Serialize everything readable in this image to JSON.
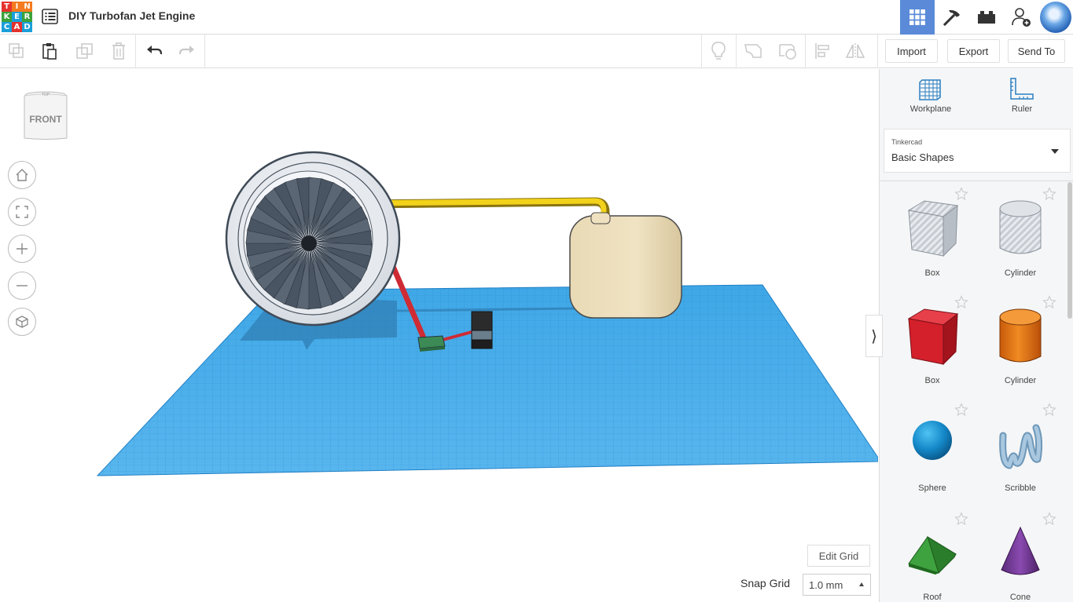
{
  "app": {
    "logo_letters": [
      "T",
      "I",
      "N",
      "K",
      "E",
      "R",
      "C",
      "A",
      "D"
    ],
    "logo_colors": [
      "#e5322e",
      "#f47b20",
      "#f47b20",
      "#3ca23c",
      "#1a9fd9",
      "#3ca23c",
      "#1a9fd9",
      "#e5322e",
      "#1a9fd9"
    ],
    "document_title": "DIY Turbofan Jet Engine",
    "accent": "#5a8ad8"
  },
  "toolbar": {
    "import_label": "Import",
    "export_label": "Export",
    "send_to_label": "Send To"
  },
  "canvas": {
    "viewcube_label": "FRONT",
    "viewcube_top_label": "TOP",
    "edit_grid_label": "Edit Grid",
    "snap_grid_label": "Snap Grid",
    "snap_grid_value": "1.0 mm",
    "workplane_color": "#2f9be0"
  },
  "panel": {
    "workplane_label": "Workplane",
    "ruler_label": "Ruler",
    "library_provider": "Tinkercad",
    "library_name": "Basic Shapes",
    "shapes": [
      {
        "label": "Box",
        "icon": "box-hole-icon"
      },
      {
        "label": "Cylinder",
        "icon": "cylinder-hole-icon"
      },
      {
        "label": "Box",
        "icon": "box-icon"
      },
      {
        "label": "Cylinder",
        "icon": "cylinder-icon"
      },
      {
        "label": "Sphere",
        "icon": "sphere-icon"
      },
      {
        "label": "Scribble",
        "icon": "scribble-icon"
      },
      {
        "label": "Roof",
        "icon": "roof-icon"
      },
      {
        "label": "Cone",
        "icon": "cone-icon"
      }
    ]
  }
}
